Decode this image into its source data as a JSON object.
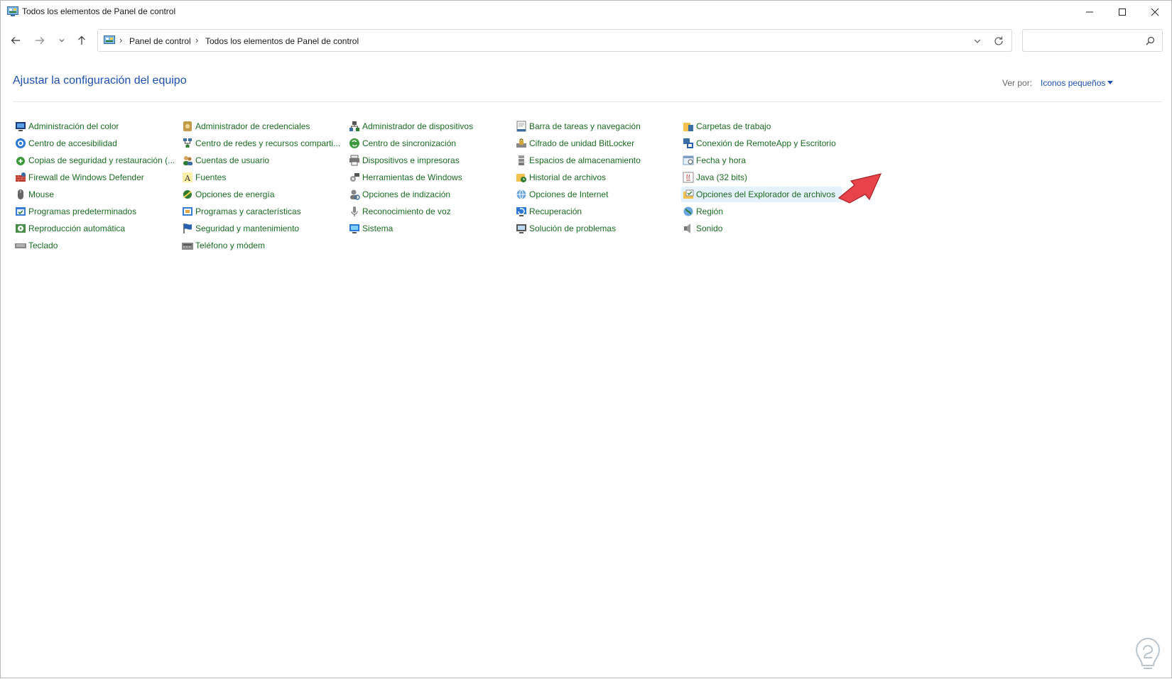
{
  "window": {
    "title": "Todos los elementos de Panel de control"
  },
  "nav": {
    "breadcrumb": [
      "Panel de control",
      "Todos los elementos de Panel de control"
    ],
    "search_placeholder": ""
  },
  "header": {
    "title": "Ajustar la configuración del equipo",
    "view_by_label": "Ver por:",
    "view_by_value": "Iconos pequeños"
  },
  "columns": [
    [
      {
        "label": "Administración del color",
        "icon": "color-management-icon"
      },
      {
        "label": "Centro de accesibilidad",
        "icon": "accessibility-icon"
      },
      {
        "label": "Copias de seguridad y restauración (...",
        "icon": "backup-icon"
      },
      {
        "label": "Firewall de Windows Defender",
        "icon": "firewall-icon"
      },
      {
        "label": "Mouse",
        "icon": "mouse-icon"
      },
      {
        "label": "Programas predeterminados",
        "icon": "default-programs-icon"
      },
      {
        "label": "Reproducción automática",
        "icon": "autoplay-icon"
      },
      {
        "label": "Teclado",
        "icon": "keyboard-icon"
      }
    ],
    [
      {
        "label": "Administrador de credenciales",
        "icon": "credentials-icon"
      },
      {
        "label": "Centro de redes y recursos comparti...",
        "icon": "network-icon"
      },
      {
        "label": "Cuentas de usuario",
        "icon": "user-accounts-icon"
      },
      {
        "label": "Fuentes",
        "icon": "fonts-icon"
      },
      {
        "label": "Opciones de energía",
        "icon": "power-icon"
      },
      {
        "label": "Programas y características",
        "icon": "programs-icon"
      },
      {
        "label": "Seguridad y mantenimiento",
        "icon": "flag-icon"
      },
      {
        "label": "Teléfono y módem",
        "icon": "phone-modem-icon"
      }
    ],
    [
      {
        "label": "Administrador de dispositivos",
        "icon": "device-manager-icon"
      },
      {
        "label": "Centro de sincronización",
        "icon": "sync-icon"
      },
      {
        "label": "Dispositivos e impresoras",
        "icon": "printer-icon"
      },
      {
        "label": "Herramientas de Windows",
        "icon": "tools-icon"
      },
      {
        "label": "Opciones de indización",
        "icon": "indexing-icon"
      },
      {
        "label": "Reconocimiento de voz",
        "icon": "microphone-icon"
      },
      {
        "label": "Sistema",
        "icon": "system-icon"
      }
    ],
    [
      {
        "label": "Barra de tareas y navegación",
        "icon": "taskbar-icon"
      },
      {
        "label": "Cifrado de unidad BitLocker",
        "icon": "bitlocker-icon"
      },
      {
        "label": "Espacios de almacenamiento",
        "icon": "storage-icon"
      },
      {
        "label": "Historial de archivos",
        "icon": "file-history-icon"
      },
      {
        "label": "Opciones de Internet",
        "icon": "internet-icon"
      },
      {
        "label": "Recuperación",
        "icon": "recovery-icon"
      },
      {
        "label": "Solución de problemas",
        "icon": "troubleshoot-icon"
      }
    ],
    [
      {
        "label": "Carpetas de trabajo",
        "icon": "work-folders-icon"
      },
      {
        "label": "Conexión de RemoteApp y Escritorio",
        "icon": "remoteapp-icon"
      },
      {
        "label": "Fecha y hora",
        "icon": "date-time-icon"
      },
      {
        "label": "Java (32 bits)",
        "icon": "java-icon"
      },
      {
        "label": "Opciones del Explorador de archivos",
        "icon": "folder-options-icon"
      },
      {
        "label": "Región",
        "icon": "region-icon"
      },
      {
        "label": "Sonido",
        "icon": "speaker-icon"
      }
    ]
  ],
  "colors": {
    "link_green": "#1b6b21",
    "title_blue": "#1e4fb0",
    "highlight": "#e5f1fb",
    "callout_arrow": "#e8424a"
  }
}
